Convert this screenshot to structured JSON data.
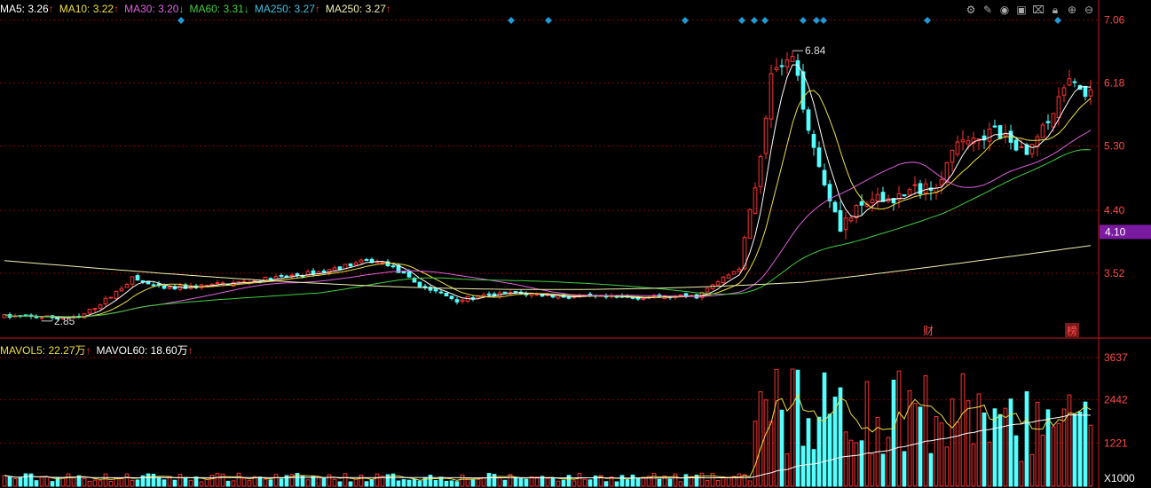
{
  "legend_price": [
    {
      "label": "MA5",
      "value": "3.26",
      "arrow": "↑",
      "color": "#ffffff"
    },
    {
      "label": "MA10",
      "value": "3.22",
      "arrow": "↑",
      "color": "#f0e040"
    },
    {
      "label": "MA30",
      "value": "3.20",
      "arrow": "↓",
      "color": "#e060e0"
    },
    {
      "label": "MA60",
      "value": "3.31",
      "arrow": "↓",
      "color": "#40d040"
    },
    {
      "label": "MA250",
      "value": "3.27",
      "arrow": "↑",
      "color": "#40c0e0"
    },
    {
      "label": "MA250",
      "value": "3.27",
      "arrow": "↑",
      "color": "#f0f0b0"
    }
  ],
  "legend_volume": [
    {
      "label": "MAVOL5",
      "value": "22.27万",
      "arrow": "↑",
      "color": "#f0e040"
    },
    {
      "label": "MAVOL60",
      "value": "18.60万",
      "arrow": "↑",
      "color": "#ffffff"
    }
  ],
  "toolbar_icons": [
    "settings-icon",
    "pencil-icon",
    "eye-icon",
    "lock-box-icon",
    "crop-icon",
    "lock-icon",
    "zoom-in-icon",
    "zoom-out-icon"
  ],
  "colors": {
    "up": "#ff3232",
    "down": "#54ffff",
    "grid": "#8b0000",
    "axis": "#c81e1e",
    "current_price_bg": "#7a1aa0",
    "marker": "#1e9ad6"
  },
  "chart_data": {
    "type": "candlestick",
    "price_axis_ticks": [
      "7.06",
      "6.18",
      "5.30",
      "4.40",
      "3.52"
    ],
    "price_range": [
      2.63,
      7.24
    ],
    "current_price": "4.10",
    "high_label": "6.84",
    "low_label": "2.85",
    "annotations": [
      "财",
      "榜"
    ],
    "volume_axis_ticks": [
      "3637",
      "2442",
      "1221"
    ],
    "volume_unit": "X1000",
    "volume_range": [
      0,
      3637
    ],
    "event_marker_count": 12
  }
}
